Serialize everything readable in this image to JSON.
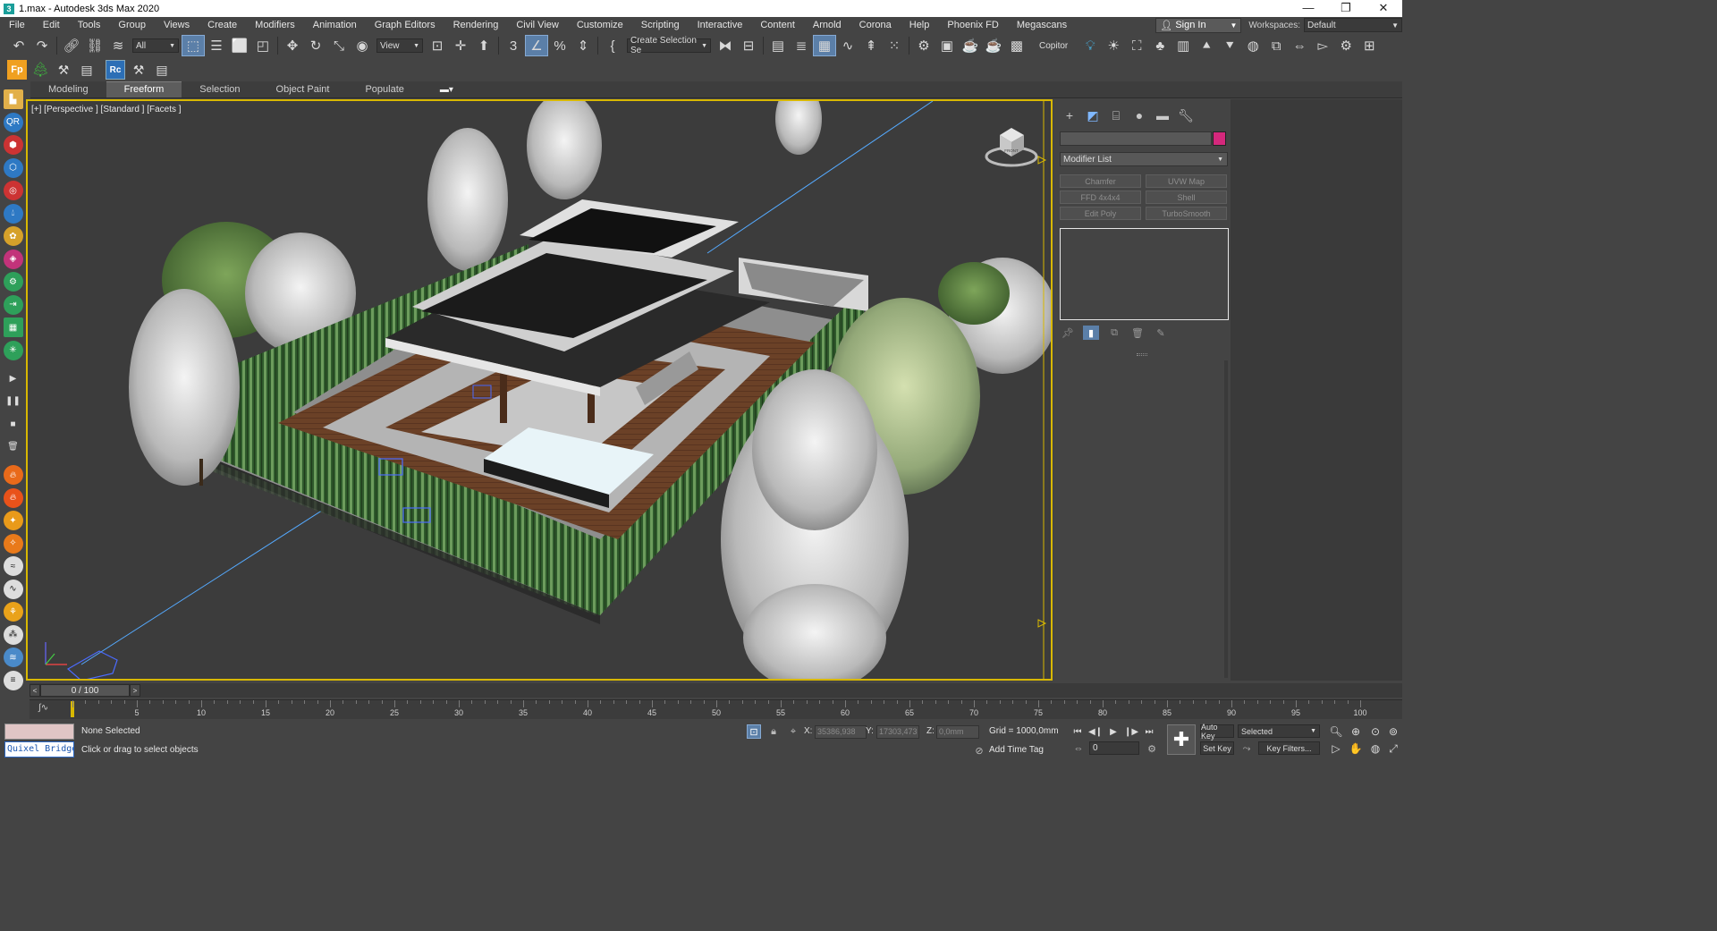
{
  "window": {
    "title": "1.max - Autodesk 3ds Max 2020",
    "controls": [
      "—",
      "❐",
      "✕"
    ]
  },
  "menubar": {
    "items": [
      "File",
      "Edit",
      "Tools",
      "Group",
      "Views",
      "Create",
      "Modifiers",
      "Animation",
      "Graph Editors",
      "Rendering",
      "Civil View",
      "Customize",
      "Scripting",
      "Interactive",
      "Content",
      "Arnold",
      "Corona",
      "Help",
      "Phoenix FD",
      "Megascans"
    ],
    "sign_in": "Sign In",
    "workspaces_label": "Workspaces:",
    "workspace_value": "Default"
  },
  "toolbar": {
    "selection_filter": "All",
    "reference_coord": "View",
    "named_selection": "Create Selection Se",
    "copitor": "Copitor"
  },
  "ribbon": {
    "tabs": [
      "Modeling",
      "Freeform",
      "Selection",
      "Object Paint",
      "Populate"
    ],
    "active_tab": "Freeform",
    "options_glyph": "▬▾"
  },
  "viewport": {
    "label": "[+] [Perspective ] [Standard ] [Facets ]",
    "viewcube_face": "FRONT"
  },
  "command_panel": {
    "modifier_list": "Modifier List",
    "object_color": "#d4287c",
    "modifiers": [
      "Chamfer",
      "UVW Map",
      "FFD 4x4x4",
      "Shell",
      "Edit Poly",
      "TurboSmooth"
    ]
  },
  "timeline": {
    "frame_display": "0 / 100",
    "ticks": [
      "5",
      "10",
      "15",
      "20",
      "25",
      "30",
      "35",
      "40",
      "45",
      "50",
      "55",
      "60",
      "65",
      "70",
      "75",
      "80",
      "85",
      "90",
      "95",
      "100"
    ]
  },
  "status": {
    "selection": "None Selected",
    "prompt": "Click or drag to select objects",
    "quixel": "Quixel Bridge",
    "x_label": "X:",
    "x_value": "35386,938",
    "y_label": "Y:",
    "y_value": "17303,473",
    "z_label": "Z:",
    "z_value": "0,0mm",
    "grid": "Grid = 1000,0mm",
    "add_time_tag": "Add Time Tag",
    "current_frame": "0",
    "auto_key": "Auto Key",
    "set_key": "Set Key",
    "key_mode": "Selected",
    "key_filters": "Key Filters..."
  }
}
